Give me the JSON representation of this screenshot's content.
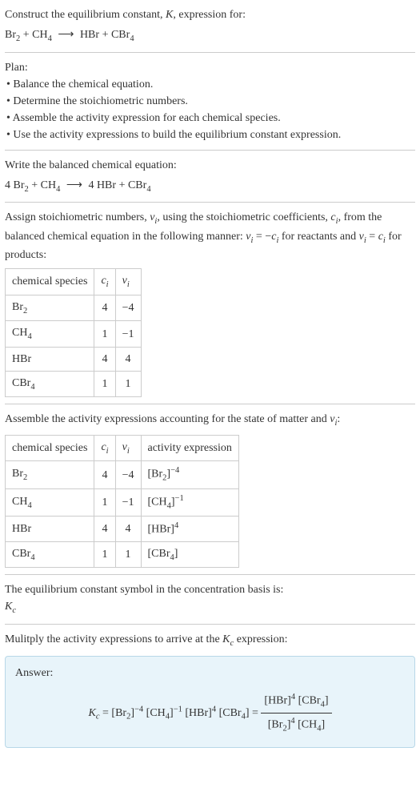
{
  "intro": {
    "line1_pre": "Construct the equilibrium constant, ",
    "line1_k": "K",
    "line1_post": ", expression for:",
    "reactant1_base": "Br",
    "reactant1_sub": "2",
    "plus": " + ",
    "reactant2_base": "CH",
    "reactant2_sub": "4",
    "arrow": "⟶",
    "product1": "HBr",
    "product2_base": "CBr",
    "product2_sub": "4"
  },
  "plan": {
    "heading": "Plan:",
    "b1": "• Balance the chemical equation.",
    "b2": "• Determine the stoichiometric numbers.",
    "b3": "• Assemble the activity expression for each chemical species.",
    "b4": "• Use the activity expressions to build the equilibrium constant expression."
  },
  "balanced": {
    "heading": "Write the balanced chemical equation:",
    "r1_coef": "4 ",
    "r1_base": "Br",
    "r1_sub": "2",
    "r2_base": "CH",
    "r2_sub": "4",
    "p1_coef": "4 ",
    "p1": "HBr",
    "p2_base": "CBr",
    "p2_sub": "4"
  },
  "stoich_text": {
    "t1": "Assign stoichiometric numbers, ",
    "v": "ν",
    "i": "i",
    "t2": ", using the stoichiometric coefficients, ",
    "c": "c",
    "t3": ", from the balanced chemical equation in the following manner: ",
    "eq1_lhs_v": "ν",
    "eq1_rhs_neg": " = −",
    "eq1_rhs_c": "c",
    "t4": " for reactants and ",
    "eq2_mid": " = ",
    "t5": " for products:"
  },
  "table1": {
    "h1": "chemical species",
    "h2_c": "c",
    "h2_i": "i",
    "h3_v": "ν",
    "h3_i": "i",
    "r1_s": "Br",
    "r1_sub": "2",
    "r1_c": "4",
    "r1_v": "−4",
    "r2_s": "CH",
    "r2_sub": "4",
    "r2_c": "1",
    "r2_v": "−1",
    "r3_s": "HBr",
    "r3_c": "4",
    "r3_v": "4",
    "r4_s": "CBr",
    "r4_sub": "4",
    "r4_c": "1",
    "r4_v": "1"
  },
  "activity_text": {
    "t1": "Assemble the activity expressions accounting for the state of matter and ",
    "v": "ν",
    "i": "i",
    "t2": ":"
  },
  "table2": {
    "h1": "chemical species",
    "h2_c": "c",
    "h2_i": "i",
    "h3_v": "ν",
    "h3_i": "i",
    "h4": "activity expression",
    "r1_s": "Br",
    "r1_sub": "2",
    "r1_c": "4",
    "r1_v": "−4",
    "r1_a_base": "[Br",
    "r1_a_sub": "2",
    "r1_a_close": "]",
    "r1_a_sup": "−4",
    "r2_s": "CH",
    "r2_sub": "4",
    "r2_c": "1",
    "r2_v": "−1",
    "r2_a_base": "[CH",
    "r2_a_sub": "4",
    "r2_a_close": "]",
    "r2_a_sup": "−1",
    "r3_s": "HBr",
    "r3_c": "4",
    "r3_v": "4",
    "r3_a_base": "[HBr]",
    "r3_a_sup": "4",
    "r4_s": "CBr",
    "r4_sub": "4",
    "r4_c": "1",
    "r4_v": "1",
    "r4_a_base": "[CBr",
    "r4_a_sub": "4",
    "r4_a_close": "]"
  },
  "symbol_text": {
    "t1": "The equilibrium constant symbol in the concentration basis is:",
    "k": "K",
    "ksub": "c"
  },
  "multiply_text": {
    "t1": "Mulitply the activity expressions to arrive at the ",
    "k": "K",
    "ksub": "c",
    "t2": " expression:"
  },
  "answer": {
    "label": "Answer:",
    "kc_k": "K",
    "kc_sub": "c",
    "eq": " = ",
    "t1_b1": "[Br",
    "t1_s1": "2",
    "t1_c1": "]",
    "t1_e1": "−4",
    "sp": " ",
    "t2_b": "[CH",
    "t2_s": "4",
    "t2_c": "]",
    "t2_e": "−1",
    "t3_b": "[HBr]",
    "t3_e": "4",
    "t4_b": "[CBr",
    "t4_s": "4",
    "t4_c": "]",
    "eq2": " = ",
    "num_t1_b": "[HBr]",
    "num_t1_e": "4",
    "num_t2_b": "[CBr",
    "num_t2_s": "4",
    "num_t2_c": "]",
    "den_t1_b": "[Br",
    "den_t1_s": "2",
    "den_t1_c": "]",
    "den_t1_e": "4",
    "den_t2_b": "[CH",
    "den_t2_s": "4",
    "den_t2_c": "]"
  }
}
